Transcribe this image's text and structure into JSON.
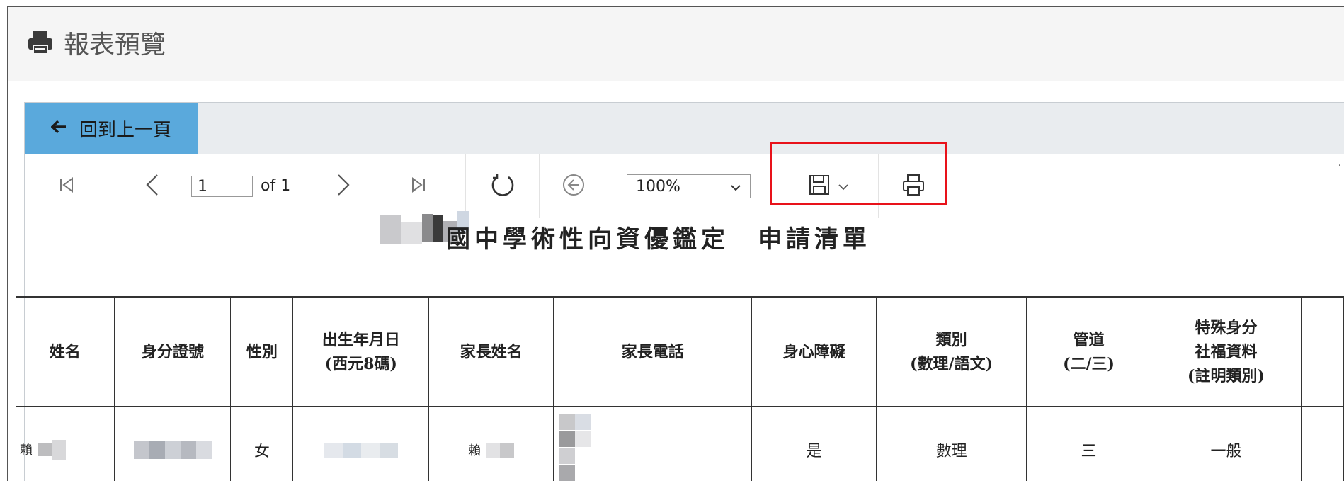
{
  "panel": {
    "title": "報表預覽",
    "icon": "print-icon"
  },
  "nav": {
    "back_label": "回到上一頁",
    "back_icon": "arrow-left-icon"
  },
  "toolbar": {
    "page_value": "1",
    "page_total_label": "of 1",
    "zoom_value": "100%",
    "icons": [
      "first-page-icon",
      "prev-page-icon",
      "next-page-icon",
      "last-page-icon",
      "refresh-icon",
      "back-to-parent-icon",
      "save-icon",
      "chevron-down-icon",
      "print-icon"
    ]
  },
  "report": {
    "title": "國中學術性向資優鑑定　申請清單",
    "columns": [
      [
        "姓名"
      ],
      [
        "身分證號"
      ],
      [
        "性別"
      ],
      [
        "出生年月日",
        "(西元8碼)"
      ],
      [
        "家長姓名"
      ],
      [
        "家長電話"
      ],
      [
        "身心障礙"
      ],
      [
        "類別",
        "(數理/語文)"
      ],
      [
        "管道",
        "(二/三)"
      ],
      [
        "特殊身分",
        "社福資料",
        "(註明類別)"
      ]
    ],
    "rows": [
      {
        "name_prefix": "賴",
        "gender": "女",
        "parent_prefix": "賴",
        "disability": "是",
        "category": "數理",
        "channel": "三",
        "special": "一般"
      }
    ]
  },
  "colors": {
    "back_button": "#5aa9dc",
    "highlight_box": "#e8121a",
    "tabbar": "#e9ecef"
  }
}
